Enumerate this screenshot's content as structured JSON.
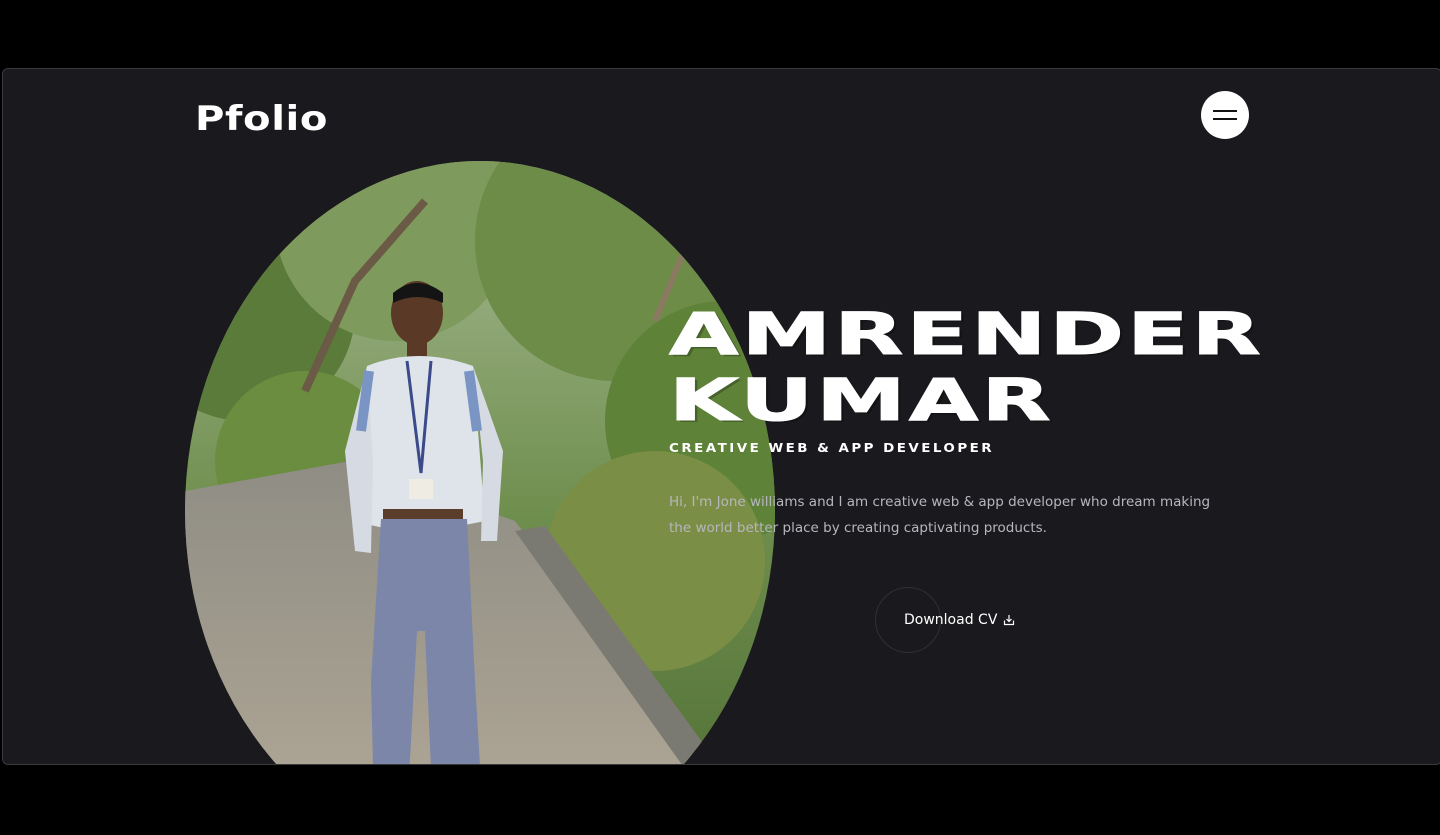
{
  "header": {
    "logo": "Pfolio",
    "menu_icon": "hamburger-icon"
  },
  "hero": {
    "name_line1": "AMRENDER",
    "name_line2": "KUMAR",
    "subtitle": "CREATIVE WEB & APP DEVELOPER",
    "bio": "Hi, I'm Jone williams and I am creative web & app developer who dream making the world better place by creating captivating products.",
    "download_label": "Download CV",
    "download_icon": "download-icon"
  },
  "colors": {
    "background": "#1a1a1e",
    "text": "#ffffff",
    "muted": "#b6b6bd"
  }
}
